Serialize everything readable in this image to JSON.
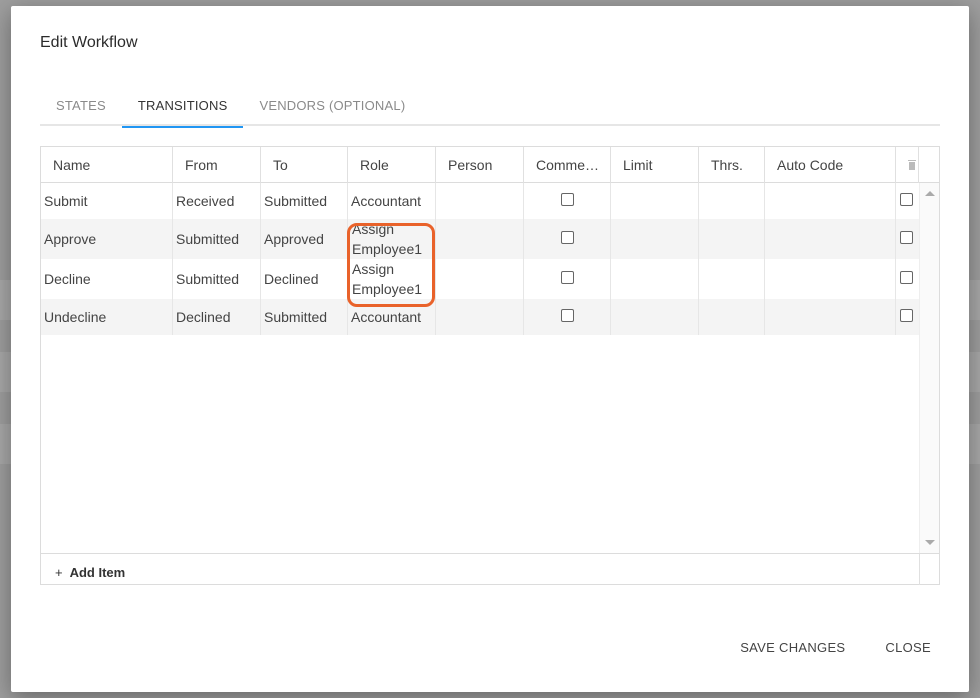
{
  "dialog": {
    "title": "Edit Workflow"
  },
  "tabs": [
    {
      "label": "STATES",
      "active": false
    },
    {
      "label": "TRANSITIONS",
      "active": true
    },
    {
      "label": "VENDORS (OPTIONAL)",
      "active": false
    }
  ],
  "columns": [
    "Name",
    "From",
    "To",
    "Role",
    "Person",
    "Comme…",
    "Limit",
    "Thrs.",
    "Auto Code"
  ],
  "delete_column_icon": "trash-icon",
  "rows": [
    {
      "name": "Submit",
      "from": "Received",
      "to": "Submitted",
      "role": "Accountant",
      "person": "",
      "comment": false,
      "limit": "",
      "thrs": "",
      "auto_code": "",
      "selected": false
    },
    {
      "name": "Approve",
      "from": "Submitted",
      "to": "Approved",
      "role": "Assign Employee1",
      "person": "",
      "comment": false,
      "limit": "",
      "thrs": "",
      "auto_code": "",
      "selected": false
    },
    {
      "name": "Decline",
      "from": "Submitted",
      "to": "Declined",
      "role": "Assign Employee1",
      "person": "",
      "comment": false,
      "limit": "",
      "thrs": "",
      "auto_code": "",
      "selected": false
    },
    {
      "name": "Undecline",
      "from": "Declined",
      "to": "Submitted",
      "role": "Accountant",
      "person": "",
      "comment": false,
      "limit": "",
      "thrs": "",
      "auto_code": "",
      "selected": false
    }
  ],
  "add_item": {
    "plus": "+",
    "label": "Add Item"
  },
  "buttons": {
    "save": "SAVE CHANGES",
    "close": "CLOSE"
  },
  "colors": {
    "tab_underline": "#2196f3",
    "highlight": "#e9622a"
  }
}
